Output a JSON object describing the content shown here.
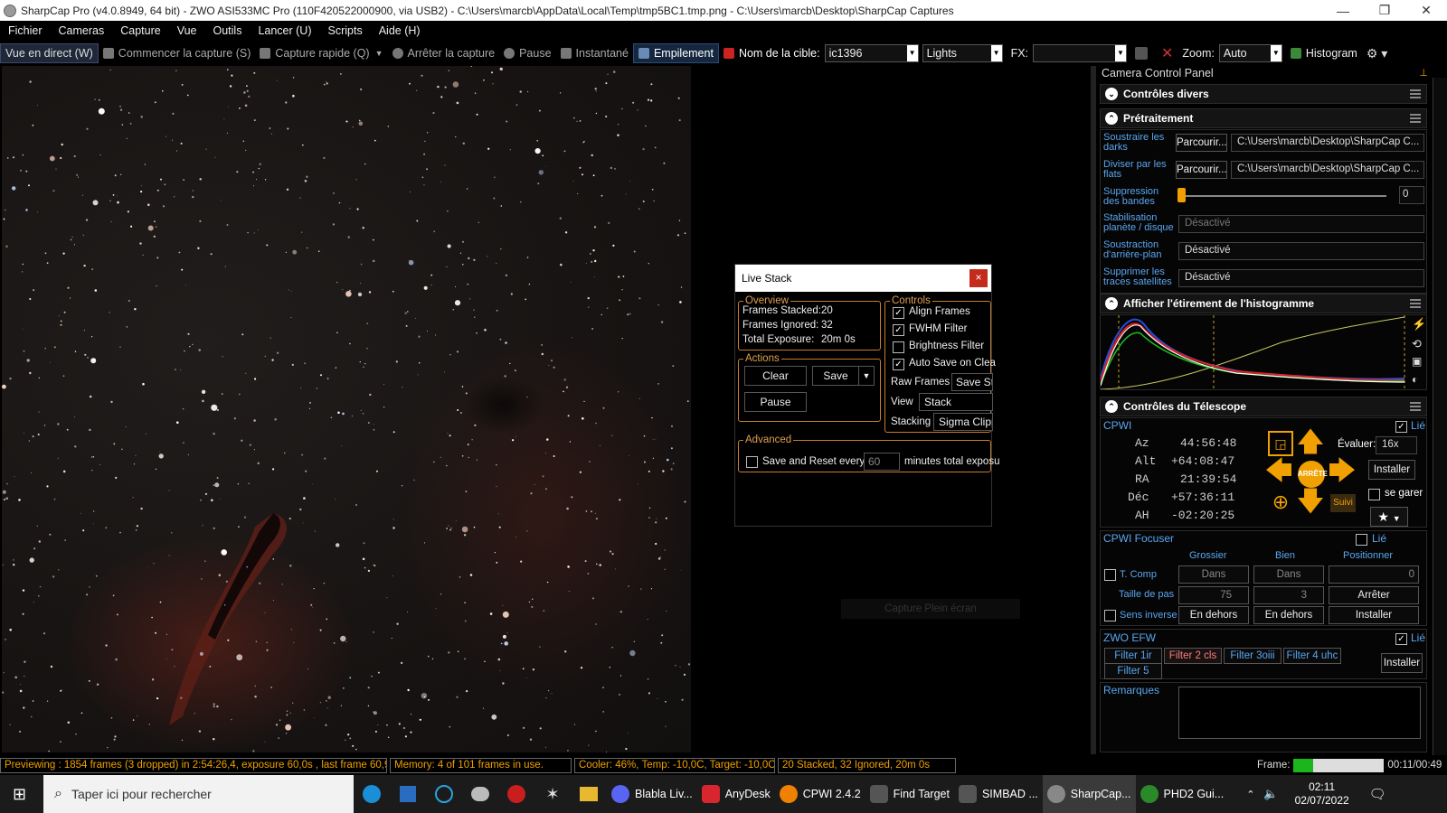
{
  "window": {
    "title": "SharpCap Pro (v4.0.8949, 64 bit) - ZWO ASI533MC Pro (110F420522000900, via USB2) - C:\\Users\\marcb\\AppData\\Local\\Temp\\tmp5BC1.tmp.png - C:\\Users\\marcb\\Desktop\\SharpCap Captures",
    "minimize": "—",
    "maximize": "❐",
    "close": "✕"
  },
  "menu": [
    "Fichier",
    "Cameras",
    "Capture",
    "Vue",
    "Outils",
    "Lancer (U)",
    "Scripts",
    "Aide (H)"
  ],
  "toolbar": {
    "live_view": "Vue en direct (W)",
    "start_capture": "Commencer la capture (S)",
    "quick_capture": "Capture rapide (Q)",
    "stop_capture": "Arrêter la capture",
    "pause": "Pause",
    "snapshot": "Instantané",
    "stacking": "Empilement",
    "target_label": "Nom de la cible:",
    "target_value": "ic1396",
    "frame_type": "Lights",
    "fx_label": "FX:",
    "fx_value": "",
    "zoom_label": "Zoom:",
    "zoom_value": "Auto",
    "histogram": "Histogram"
  },
  "live_stack": {
    "title": "Live Stack",
    "close": "×",
    "overview": {
      "legend": "Overview",
      "frames_stacked_label": "Frames Stacked:",
      "frames_stacked": "20",
      "frames_ignored_label": "Frames Ignored:",
      "frames_ignored": "32",
      "total_exposure_label": "Total Exposure:",
      "total_exposure": "20m 0s"
    },
    "actions": {
      "legend": "Actions",
      "clear": "Clear",
      "save": "Save",
      "pause": "Pause"
    },
    "controls": {
      "legend": "Controls",
      "align_frames": "Align Frames",
      "align_checked": true,
      "fwhm_filter": "FWHM Filter",
      "fwhm_checked": true,
      "brightness_filter": "Brightness Filter",
      "brightness_checked": false,
      "auto_save": "Auto Save on Clea",
      "auto_save_checked": true,
      "raw_frames_label": "Raw Frames",
      "raw_frames_value": "Save St",
      "view_label": "View",
      "view_value": "Stack",
      "stacking_label": "Stacking",
      "stacking_value": "Sigma Clipp"
    },
    "advanced": {
      "legend": "Advanced",
      "save_reset_label": "Save and Reset every",
      "minutes_value": "60",
      "minutes_suffix": "minutes total exposu"
    },
    "capture_fullscreen": "Capture Plein écran"
  },
  "ccp": {
    "title": "Camera Control Panel",
    "pin": "⊥",
    "misc": {
      "title": "Contrôles divers"
    },
    "preprocess": {
      "title": "Prétraitement",
      "darks_label": "Soustraire les darks",
      "darks_browse": "Parcourir...",
      "darks_path": "C:\\Users\\marcb\\Desktop\\SharpCap C...",
      "flats_label": "Diviser par les flats",
      "flats_browse": "Parcourir...",
      "flats_path": "C:\\Users\\marcb\\Desktop\\SharpCap C...",
      "banding_label": "Suppression des bandes",
      "banding_value": "0",
      "stab_label": "Stabilisation planète / disque",
      "stab_value": "Désactivé",
      "bg_label": "Soustraction d'arrière-plan",
      "bg_value": "Désactivé",
      "sat_label": "Supprimer les traces satellites",
      "sat_value": "Désactivé"
    },
    "histogram": {
      "title": "Afficher l'étirement de l'histogramme"
    },
    "telescope": {
      "title": "Contrôles du Télescope",
      "mount_name": "CPWI",
      "linked_label": "Lié",
      "az_label": "Az",
      "az": "44:56:48",
      "alt_label": "Alt",
      "alt": "+64:08:47",
      "ra_label": "RA",
      "ra": "21:39:54",
      "dec_label": "Déc",
      "dec": "+57:36:11",
      "ah_label": "AH",
      "ah": "-02:20:25",
      "stop": "ARRÊTE",
      "rate_label": "Évaluer:",
      "rate_value": "16x",
      "install": "Installer",
      "park": "se garer",
      "track": "Suivi",
      "star_glyph": "★"
    },
    "focuser": {
      "title": "CPWI Focuser",
      "linked_label": "Lié",
      "coarse": "Grossier",
      "fine": "Bien",
      "position": "Positionner",
      "tcomp": "T. Comp",
      "in1": "Dans",
      "in2": "Dans",
      "pos_value": "0",
      "step_label": "Taille de pas",
      "step_coarse": "75",
      "step_fine": "3",
      "stop": "Arrêter",
      "reverse": "Sens inverse",
      "out1": "En dehors",
      "out2": "En dehors",
      "install": "Installer"
    },
    "efw": {
      "title": "ZWO EFW",
      "linked_label": "Lié",
      "filters": [
        "Filter 1ir",
        "Filter 2 cls",
        "Filter 3oiii",
        "Filter 4 uhc",
        "Filter 5"
      ],
      "install": "Installer"
    },
    "notes_label": "Remarques"
  },
  "status": {
    "preview": "Previewing : 1854 frames (3 dropped) in 2:54:26,4, exposure 60,0s , last frame 60,9s",
    "memory": "Memory: 4 of 101 frames in use.",
    "cooler": "Cooler: 46%, Temp: -10,0C, Target: -10,0C",
    "stack": "20 Stacked, 32 Ignored, 20m 0s",
    "frame_label": "Frame:",
    "frame_time": "00:11/00:49",
    "frame_progress": 0.22
  },
  "taskbar": {
    "search_placeholder": "Taper ici pour rechercher",
    "apps": [
      "Blabla Liv...",
      "AnyDesk",
      "CPWI 2.4.2",
      "Find Target",
      "SIMBAD ...",
      "SharpCap...",
      "PHD2 Gui..."
    ],
    "time": "02:11",
    "date": "02/07/2022"
  },
  "colors": {
    "accent": "#f0a000",
    "label_blue": "#5aa6f0",
    "fieldset": "#c87d2b",
    "close_red": "#c42b1c"
  }
}
